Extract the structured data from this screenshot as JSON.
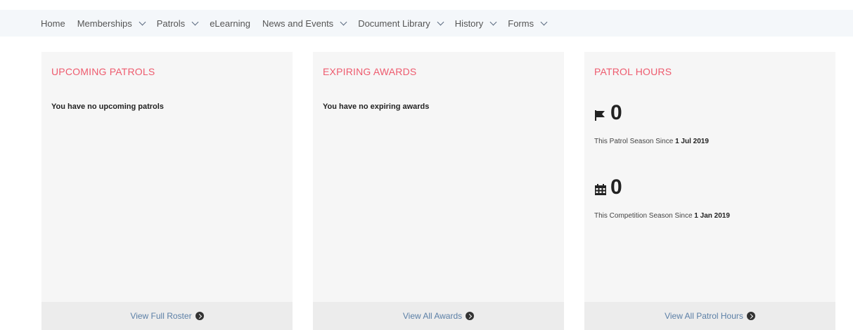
{
  "nav": {
    "items": [
      {
        "label": "Home",
        "dropdown": false
      },
      {
        "label": "Memberships",
        "dropdown": true
      },
      {
        "label": "Patrols",
        "dropdown": true
      },
      {
        "label": "eLearning",
        "dropdown": false
      },
      {
        "label": "News and Events",
        "dropdown": true
      },
      {
        "label": "Document Library",
        "dropdown": true
      },
      {
        "label": "History",
        "dropdown": true
      },
      {
        "label": "Forms",
        "dropdown": true
      }
    ]
  },
  "cards": {
    "upcoming": {
      "title": "UPCOMING PATROLS",
      "message": "You have no upcoming patrols",
      "footer_link": "View Full Roster"
    },
    "expiring": {
      "title": "EXPIRING AWARDS",
      "message": "You have no expiring awards",
      "footer_link": "View All Awards"
    },
    "hours": {
      "title": "PATROL HOURS",
      "patrol_season": {
        "value": "0",
        "icon": "flag-icon",
        "caption": "This Patrol Season Since ",
        "since": "1 Jul 2019"
      },
      "competition_season": {
        "value": "0",
        "icon": "calendar-icon",
        "caption": "This Competition Season Since ",
        "since": "1 Jan 2019"
      },
      "footer_link": "View All Patrol Hours"
    }
  },
  "colors": {
    "title_accent": "#ee5b6e",
    "link": "#5b7fa6",
    "card_bg": "#f6f6f6",
    "nav_bg": "#f4f7fa"
  }
}
